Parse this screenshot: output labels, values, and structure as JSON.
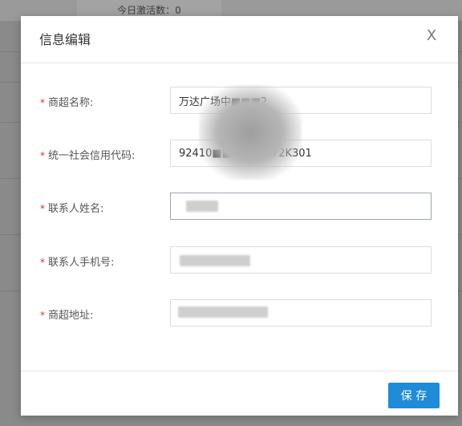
{
  "background": {
    "active_count_label": "今日激活数：0"
  },
  "dialog": {
    "title": "信息编辑",
    "close_symbol": "X",
    "required_mark": "*",
    "fields": [
      {
        "label": "商超名称:",
        "value": "万达广场中■■■2"
      },
      {
        "label": "统一社会信用代码:",
        "value": "92410■■■■A4172K301"
      },
      {
        "label": "联系人姓名:",
        "value": ""
      },
      {
        "label": "联系人手机号:",
        "value": ""
      },
      {
        "label": "商超地址:",
        "value": ""
      }
    ],
    "save_label": "保 存"
  },
  "colors": {
    "primary": "#1e8cd8",
    "required": "#e22a2a",
    "overlay": "#8a8a8a"
  }
}
